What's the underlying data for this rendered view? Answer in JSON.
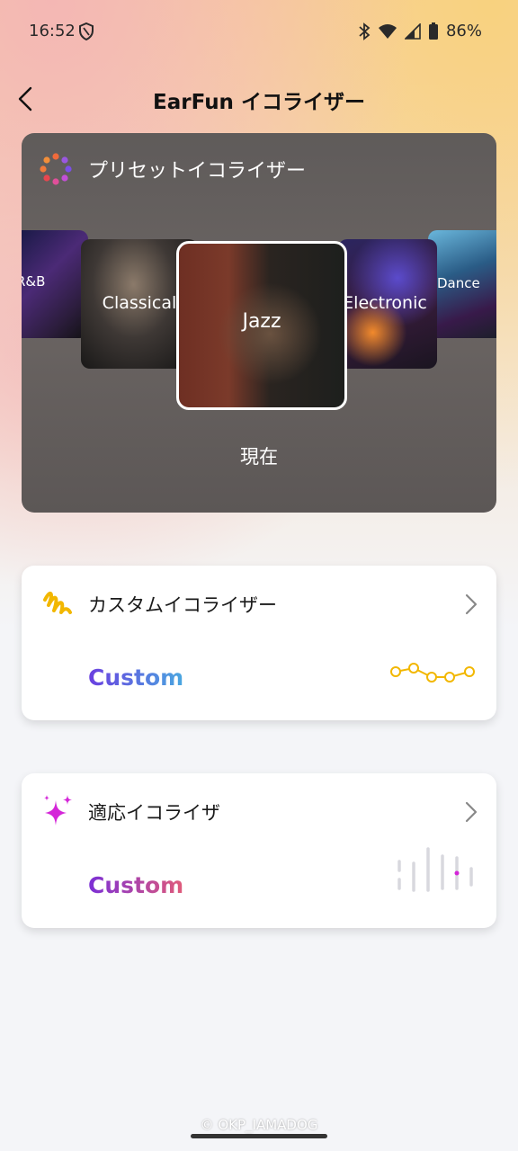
{
  "status_bar": {
    "time": "16:52",
    "battery": "86%"
  },
  "header": {
    "title": "EarFun イコライザー"
  },
  "preset_equalizer": {
    "label": "プリセットイコライザー",
    "presets": [
      {
        "name": "R&B"
      },
      {
        "name": "Classical"
      },
      {
        "name": "Jazz",
        "selected": true
      },
      {
        "name": "Electronic"
      },
      {
        "name": "Dance"
      }
    ],
    "current_label": "現在"
  },
  "custom_equalizer": {
    "label": "カスタムイコライザー",
    "value": "Custom"
  },
  "adaptive_equalizer": {
    "label": "適応イコライザ",
    "value": "Custom"
  },
  "footer": {
    "watermark": "© OKP_IAMADOG"
  },
  "colors": {
    "accent_custom": "#6a3fe0",
    "accent_adaptive": "#d426d8",
    "graph_line": "#f2b700"
  }
}
